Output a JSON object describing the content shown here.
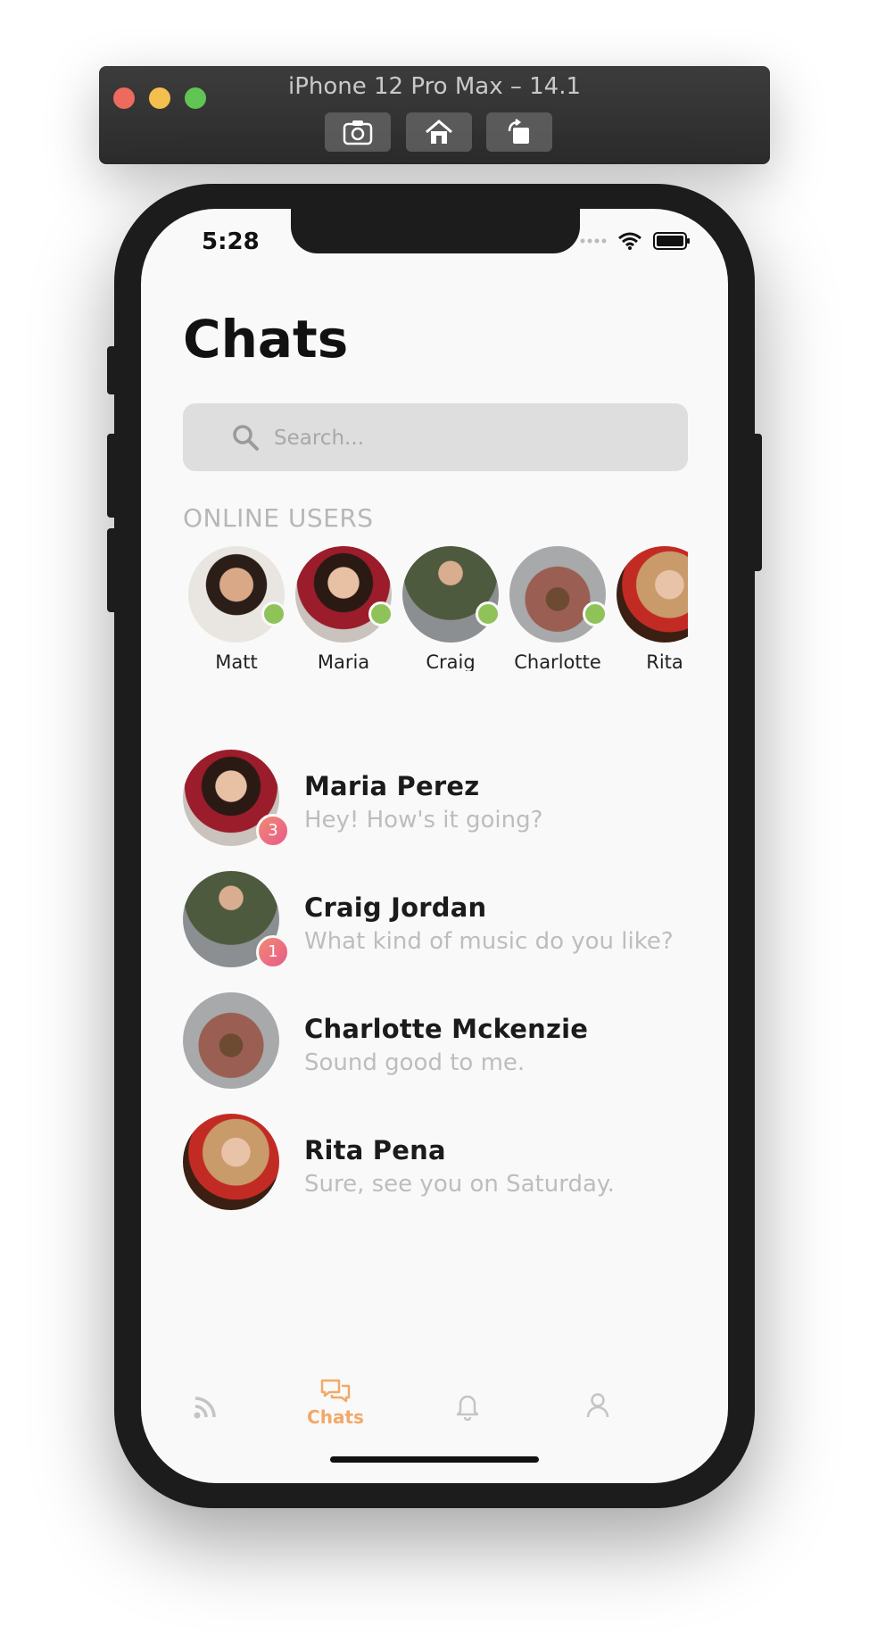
{
  "simulator": {
    "title": "iPhone 12 Pro Max – 14.1",
    "buttons": [
      "screenshot-icon",
      "home-icon",
      "rotate-icon"
    ]
  },
  "status_bar": {
    "time": "5:28"
  },
  "page": {
    "title": "Chats"
  },
  "search": {
    "placeholder": "Search..."
  },
  "online": {
    "label": "ONLINE USERS",
    "users": [
      {
        "name": "Matt",
        "online": true
      },
      {
        "name": "Maria",
        "online": true
      },
      {
        "name": "Craig",
        "online": true
      },
      {
        "name": "Charlotte",
        "online": true
      },
      {
        "name": "Rita",
        "online": false
      }
    ]
  },
  "chats": [
    {
      "name": "Maria Perez",
      "message": "Hey! How's it going?",
      "unread": "3"
    },
    {
      "name": "Craig Jordan",
      "message": "What kind of music do you like?",
      "unread": "1"
    },
    {
      "name": "Charlotte Mckenzie",
      "message": "Sound good to me.",
      "unread": ""
    },
    {
      "name": "Rita Pena",
      "message": "Sure, see you on Saturday.",
      "unread": ""
    }
  ],
  "tabbar": {
    "tabs": [
      {
        "icon": "feed-icon",
        "label": "",
        "active": false
      },
      {
        "icon": "chats-icon",
        "label": "Chats",
        "active": true
      },
      {
        "icon": "bell-icon",
        "label": "",
        "active": false
      },
      {
        "icon": "profile-icon",
        "label": "",
        "active": false
      }
    ]
  },
  "colors": {
    "accent": "#f2a969",
    "online_dot": "#8fc35a",
    "badge": "#e8677f",
    "muted_text": "#bdbdbd"
  }
}
